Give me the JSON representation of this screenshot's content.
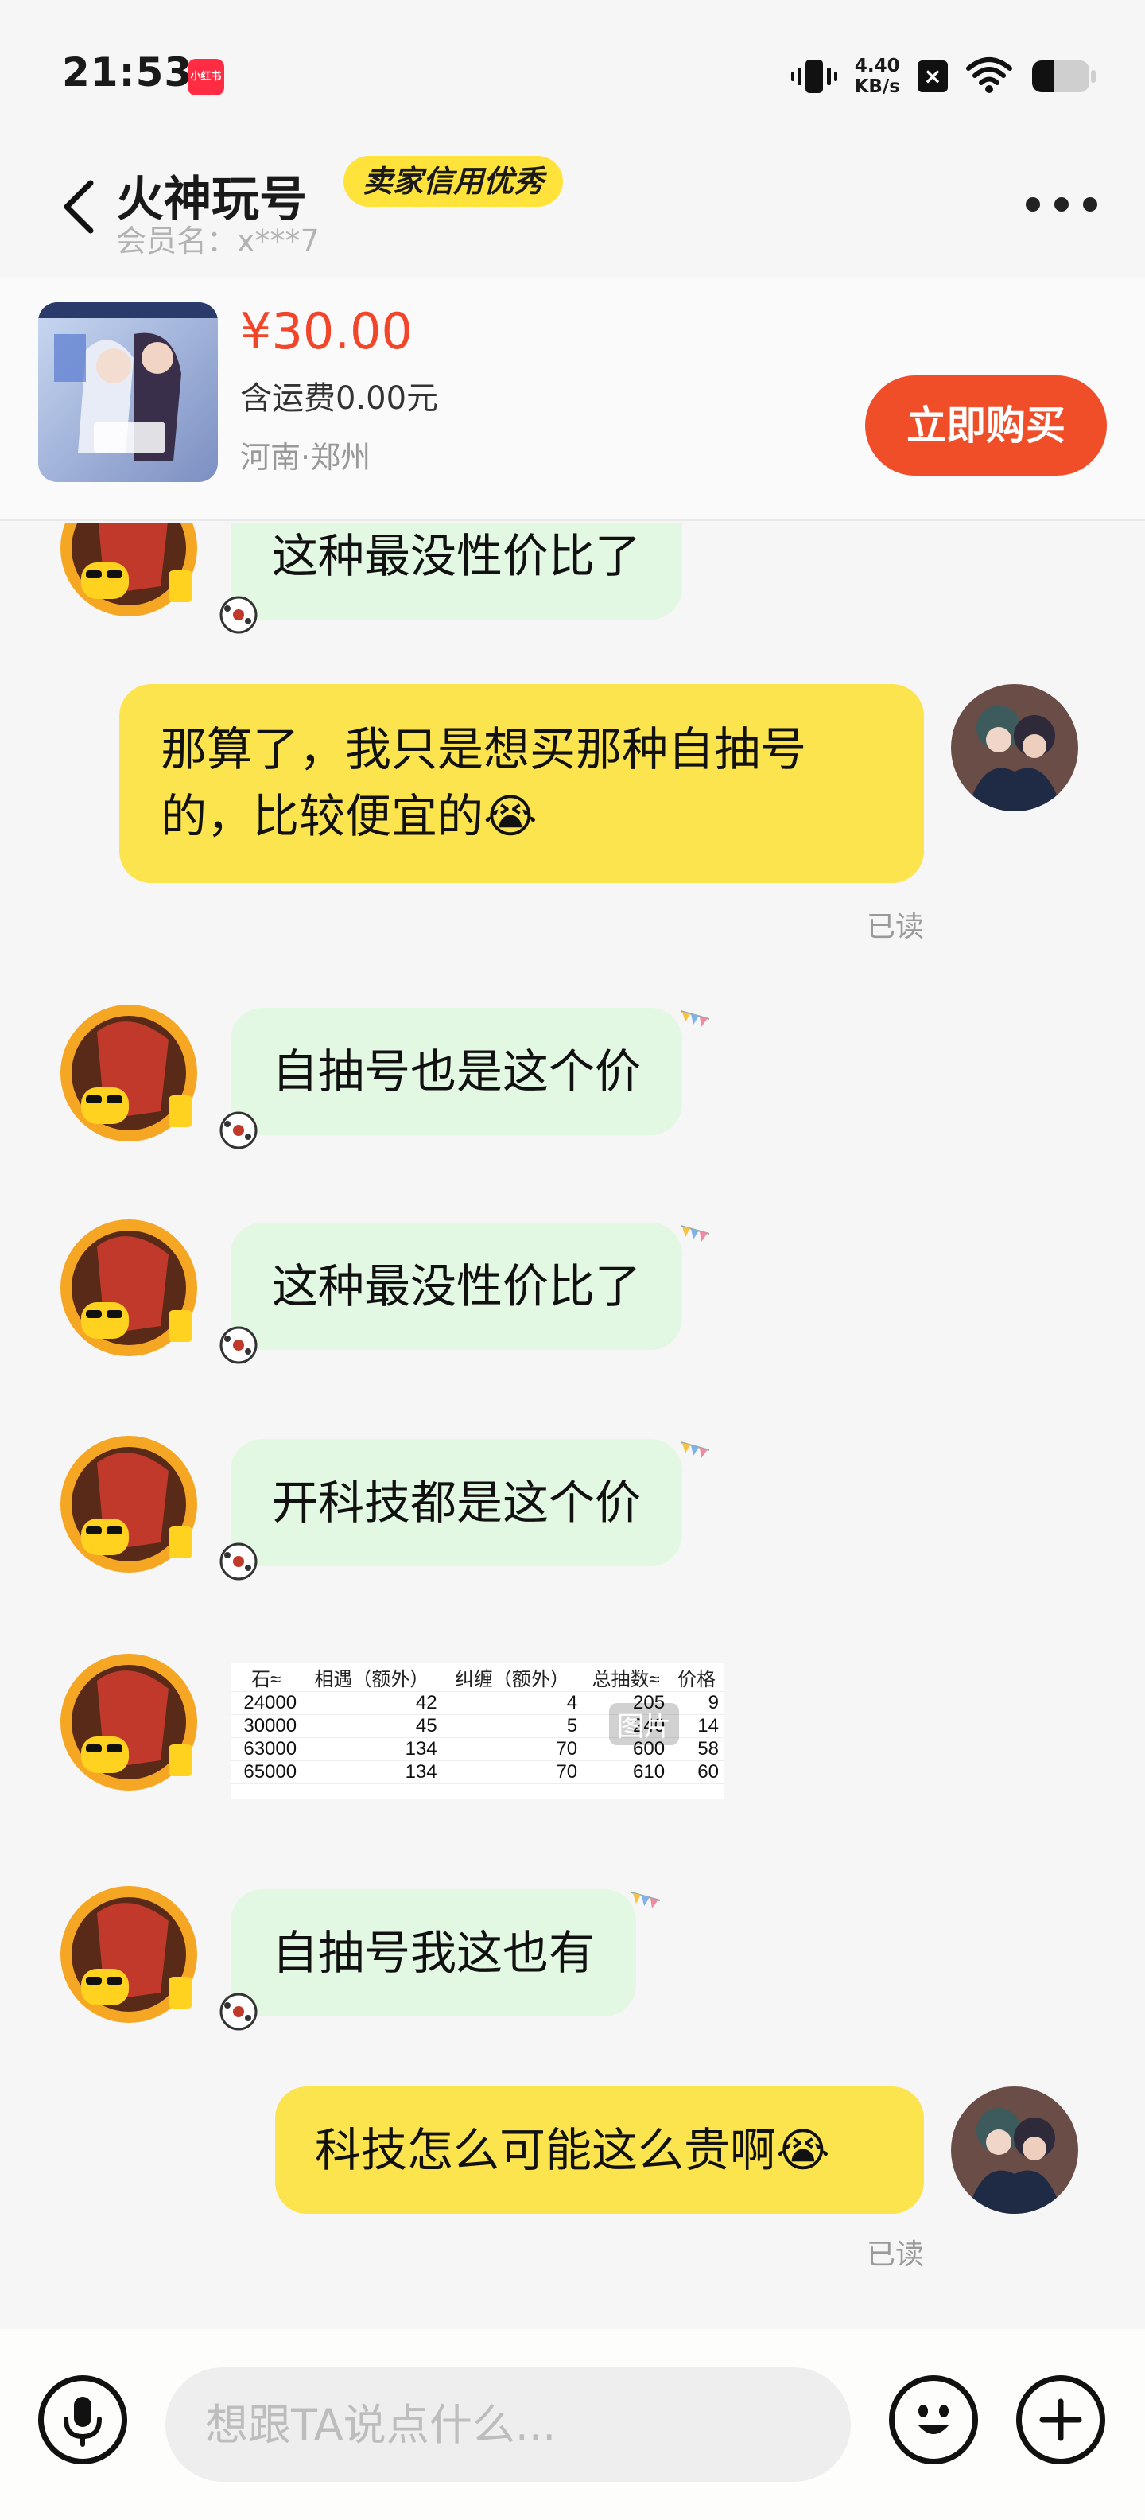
{
  "status_bar": {
    "time": "21:53",
    "app_chip": "小红书",
    "net_speed_value": "4.40",
    "net_speed_unit": "KB/s",
    "icons": [
      "vibrate-icon",
      "close-box-icon",
      "wifi-icon",
      "battery-icon"
    ]
  },
  "header": {
    "seller_name": "火神玩号",
    "credit_badge": "卖家信用优秀",
    "member_name": "会员名：x***7"
  },
  "product": {
    "price": "¥30.00",
    "shipping": "含运费0.00元",
    "location": "河南·郑州",
    "buy_label": "立即购买"
  },
  "messages": [
    {
      "from": "seller",
      "text": "这种最没性价比了"
    },
    {
      "from": "me",
      "line1": "那算了，我只是想买那种自抽号",
      "line2": "的，比较便宜的",
      "emoji": "😭",
      "read": "已读"
    },
    {
      "from": "seller",
      "text": "自抽号也是这个价"
    },
    {
      "from": "seller",
      "text": "这种最没性价比了"
    },
    {
      "from": "seller",
      "text": "开科技都是这个价"
    },
    {
      "from": "seller",
      "type": "image",
      "tag": "图片",
      "table": {
        "headers": [
          "石≈",
          "相遇（额外）",
          "纠缠（额外）",
          "总抽数≈",
          "价格"
        ],
        "rows": [
          [
            "24000",
            "42",
            "4",
            "205",
            "9"
          ],
          [
            "30000",
            "45",
            "5",
            "240",
            "14"
          ],
          [
            "63000",
            "134",
            "70",
            "600",
            "58"
          ],
          [
            "65000",
            "134",
            "70",
            "610",
            "60"
          ]
        ]
      }
    },
    {
      "from": "seller",
      "text": "自抽号我这也有"
    },
    {
      "from": "me",
      "text": "科技怎么可能这么贵啊",
      "emoji": "😭",
      "read": "已读"
    }
  ],
  "input": {
    "placeholder": "想跟TA说点什么..."
  },
  "colors": {
    "accent_orange": "#f04e29",
    "price_red": "#f2462b",
    "badge_yellow": "#ffe33a",
    "bubble_in": "#e3f8e2",
    "bubble_out": "#fbe44d"
  }
}
